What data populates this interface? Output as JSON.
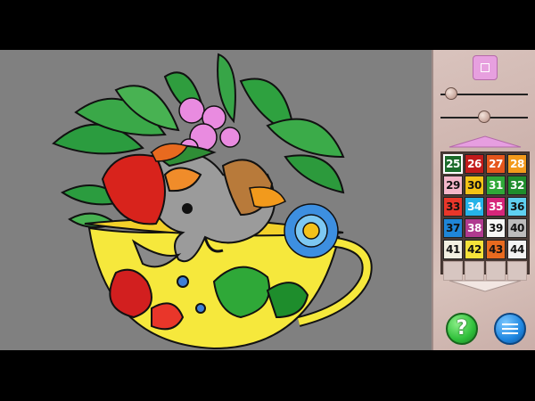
{
  "game": {
    "zoom_slider_value": 0.12,
    "brush_slider_value": 0.5,
    "icons": {
      "fit": "fit-to-screen-icon",
      "scroll_up": "triangle-up-icon",
      "scroll_down": "triangle-down-icon",
      "hint": "question-mark-icon",
      "menu": "hamburger-menu-icon"
    },
    "palette": [
      {
        "number": "25",
        "color": "#1c6b2b",
        "text": "#ffffff",
        "selected": true
      },
      {
        "number": "26",
        "color": "#c21b1b",
        "text": "#ffffff"
      },
      {
        "number": "27",
        "color": "#e5561c",
        "text": "#ffffff"
      },
      {
        "number": "28",
        "color": "#f29a1c",
        "text": "#ffffff"
      },
      {
        "number": "29",
        "color": "#f4b6c9",
        "text": "#111111"
      },
      {
        "number": "30",
        "color": "#f3c316",
        "text": "#111111"
      },
      {
        "number": "31",
        "color": "#2fa838",
        "text": "#ffffff"
      },
      {
        "number": "32",
        "color": "#1f8d2c",
        "text": "#ffffff"
      },
      {
        "number": "33",
        "color": "#e9362a",
        "text": "#111111"
      },
      {
        "number": "34",
        "color": "#25b3e8",
        "text": "#ffffff"
      },
      {
        "number": "35",
        "color": "#d6267a",
        "text": "#ffffff"
      },
      {
        "number": "36",
        "color": "#5fd0f0",
        "text": "#111111"
      },
      {
        "number": "37",
        "color": "#1f86d8",
        "text": "#111111"
      },
      {
        "number": "38",
        "color": "#b03a8f",
        "text": "#ffffff"
      },
      {
        "number": "39",
        "color": "#f7f7f5",
        "text": "#111111"
      },
      {
        "number": "40",
        "color": "#bcbcbc",
        "text": "#111111"
      },
      {
        "number": "41",
        "color": "#f3f0e2",
        "text": "#111111"
      },
      {
        "number": "42",
        "color": "#f6e23a",
        "text": "#111111"
      },
      {
        "number": "43",
        "color": "#e86a1f",
        "text": "#111111"
      },
      {
        "number": "44",
        "color": "#f3f3f3",
        "text": "#111111"
      },
      {
        "number": "",
        "color": "",
        "text": ""
      },
      {
        "number": "",
        "color": "",
        "text": ""
      },
      {
        "number": "",
        "color": "",
        "text": ""
      },
      {
        "number": "",
        "color": "",
        "text": ""
      }
    ],
    "hint_label": "?"
  }
}
